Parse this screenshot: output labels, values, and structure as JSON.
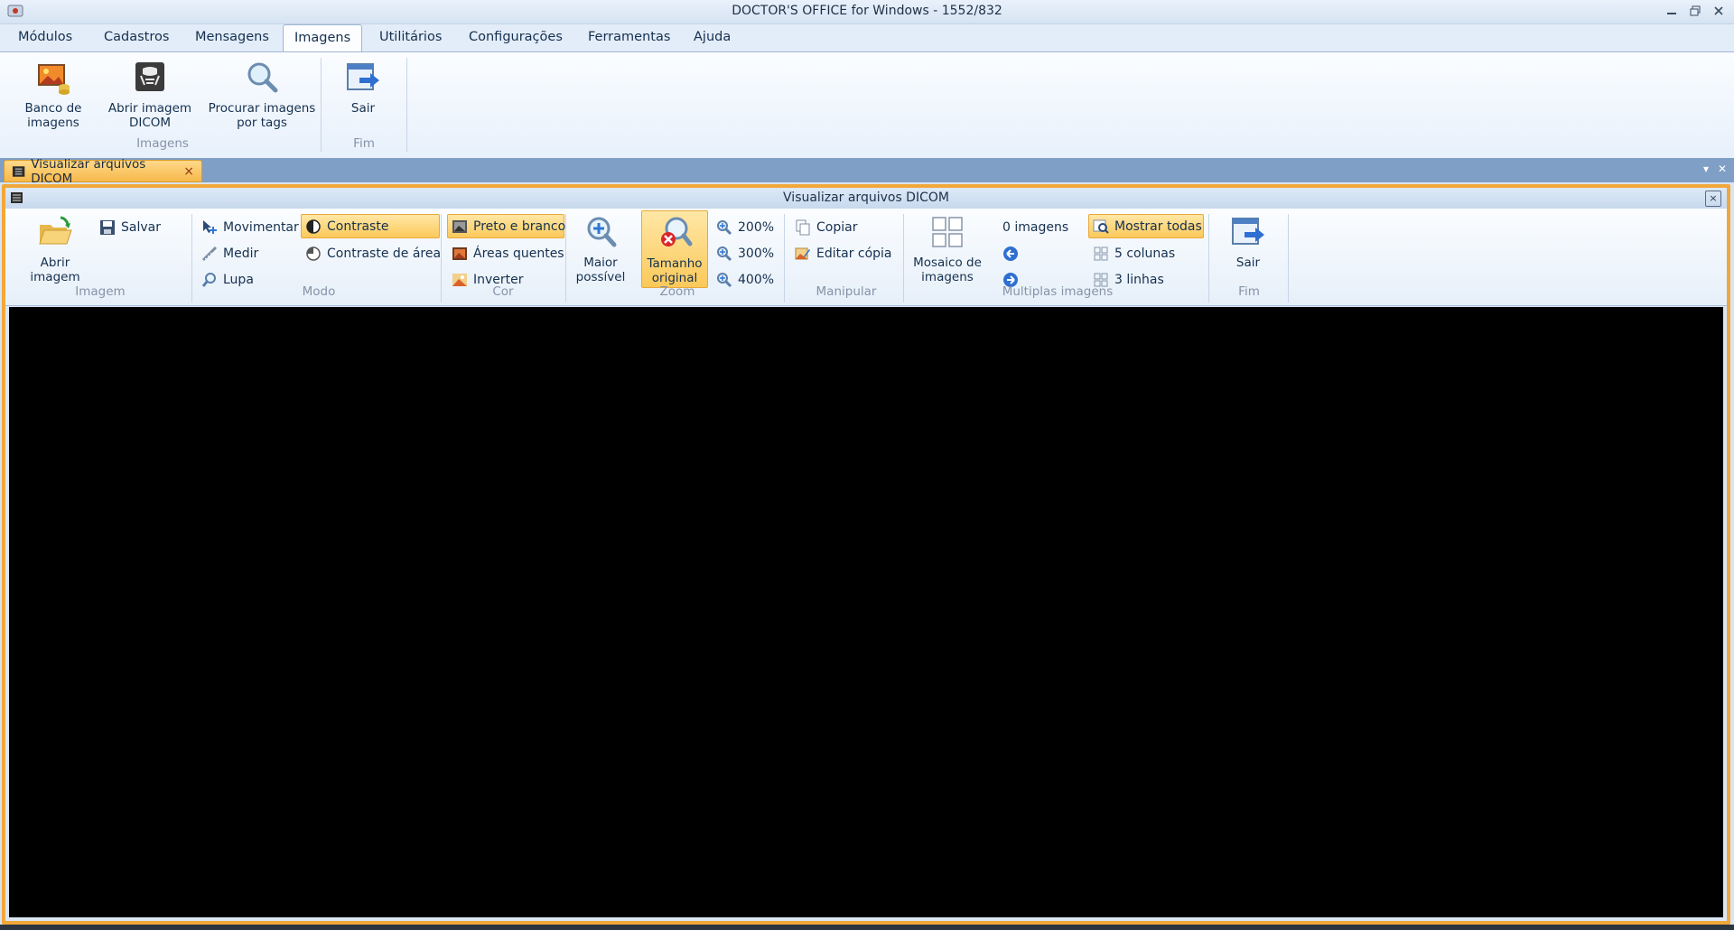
{
  "window": {
    "title": "DOCTOR'S OFFICE for Windows  - 1552/832"
  },
  "menu": [
    "Módulos",
    "Cadastros",
    "Mensagens",
    "Imagens",
    "Utilitários",
    "Configurações",
    "Ferramentas",
    "Ajuda"
  ],
  "ribbon_main": {
    "banco": [
      "Banco de",
      "imagens"
    ],
    "dicom": [
      "Abrir imagem",
      "DICOM"
    ],
    "procurar": [
      "Procurar imagens",
      "por tags"
    ],
    "sair": "Sair",
    "group_imagens": "Imagens",
    "group_fim": "Fim"
  },
  "doc_tab": {
    "label": "Visualizar arquivos DICOM",
    "close": "×"
  },
  "viewer_window": {
    "title": "Visualizar arquivos DICOM",
    "close": "×"
  },
  "ribbon_viewer": {
    "abrir": [
      "Abrir",
      "imagem"
    ],
    "salvar": "Salvar",
    "group_imagem": "Imagem",
    "movimentar": "Movimentar",
    "medir": "Medir",
    "lupa": "Lupa",
    "contraste": "Contraste",
    "contraste_area": "Contraste de área",
    "group_modo": "Modo",
    "preto_branco": "Preto e branco",
    "areas_quentes": "Áreas quentes",
    "inverter": "Inverter",
    "group_cor": "Cor",
    "maior": [
      "Maior",
      "possível"
    ],
    "tamanho": [
      "Tamanho",
      "original"
    ],
    "zoom200": "200%",
    "zoom300": "300%",
    "zoom400": "400%",
    "group_zoom": "Zoom",
    "copiar": "Copiar",
    "editar_copia": "Editar cópia",
    "group_manipular": "Manipular",
    "mosaico": [
      "Mosaico de",
      "imagens"
    ],
    "imagens_count": "0 imagens",
    "mostrar_todas": "Mostrar todas",
    "colunas": "5 colunas",
    "linhas": "3 linhas",
    "group_multiplas": "Multiplas imagens",
    "sair": "Sair",
    "group_fim": "Fim"
  },
  "colors": {
    "accent": "#f6b84a",
    "ribbon_bg": "#e7f0fb",
    "tabstrip": "#7f9fc6"
  }
}
